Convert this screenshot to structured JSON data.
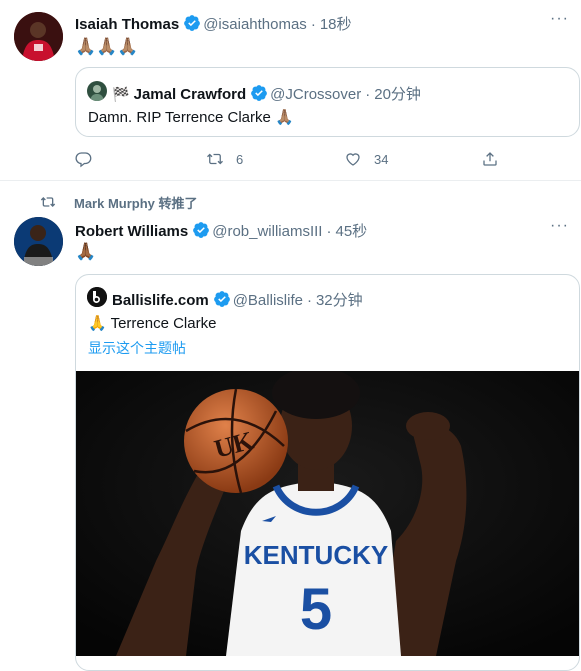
{
  "tweet1": {
    "name": "Isaiah Thomas",
    "handle": "@isaiahthomas",
    "time": "18秒",
    "separator": "·",
    "text_emoji": "🙏🏽🙏🏽🙏🏽",
    "more": "···",
    "quote": {
      "flag": "🏁",
      "name": "Jamal Crawford",
      "handle": "@JCrossover",
      "time": "20分钟",
      "text": "Damn. RIP Terrence Clarke 🙏🏽"
    },
    "actions": {
      "reply_count": "",
      "retweet_count": "6",
      "like_count": "34"
    }
  },
  "retweet_context": {
    "text": "Mark Murphy 转推了"
  },
  "tweet2": {
    "name": "Robert Williams",
    "handle": "@rob_williamsIII",
    "time": "45秒",
    "separator": "·",
    "text_emoji": "🙏🏾",
    "more": "···",
    "quote": {
      "name": "Ballislife.com",
      "handle": "@Ballislife",
      "time": "32分钟",
      "text": "🙏 Terrence Clarke",
      "show_thread": "显示这个主题帖",
      "photo": {
        "jersey_text": "KENTUCKY",
        "jersey_number": "5",
        "ball_logo": "UK"
      }
    }
  },
  "colors": {
    "blue": "#1d9bf0",
    "muted": "#5b7083",
    "border": "#cfd9de"
  },
  "icons": [
    "verified-badge-icon",
    "more-icon",
    "reply-icon",
    "retweet-icon",
    "like-icon",
    "share-icon",
    "pray-emoji",
    "checkered-flag-emoji"
  ]
}
